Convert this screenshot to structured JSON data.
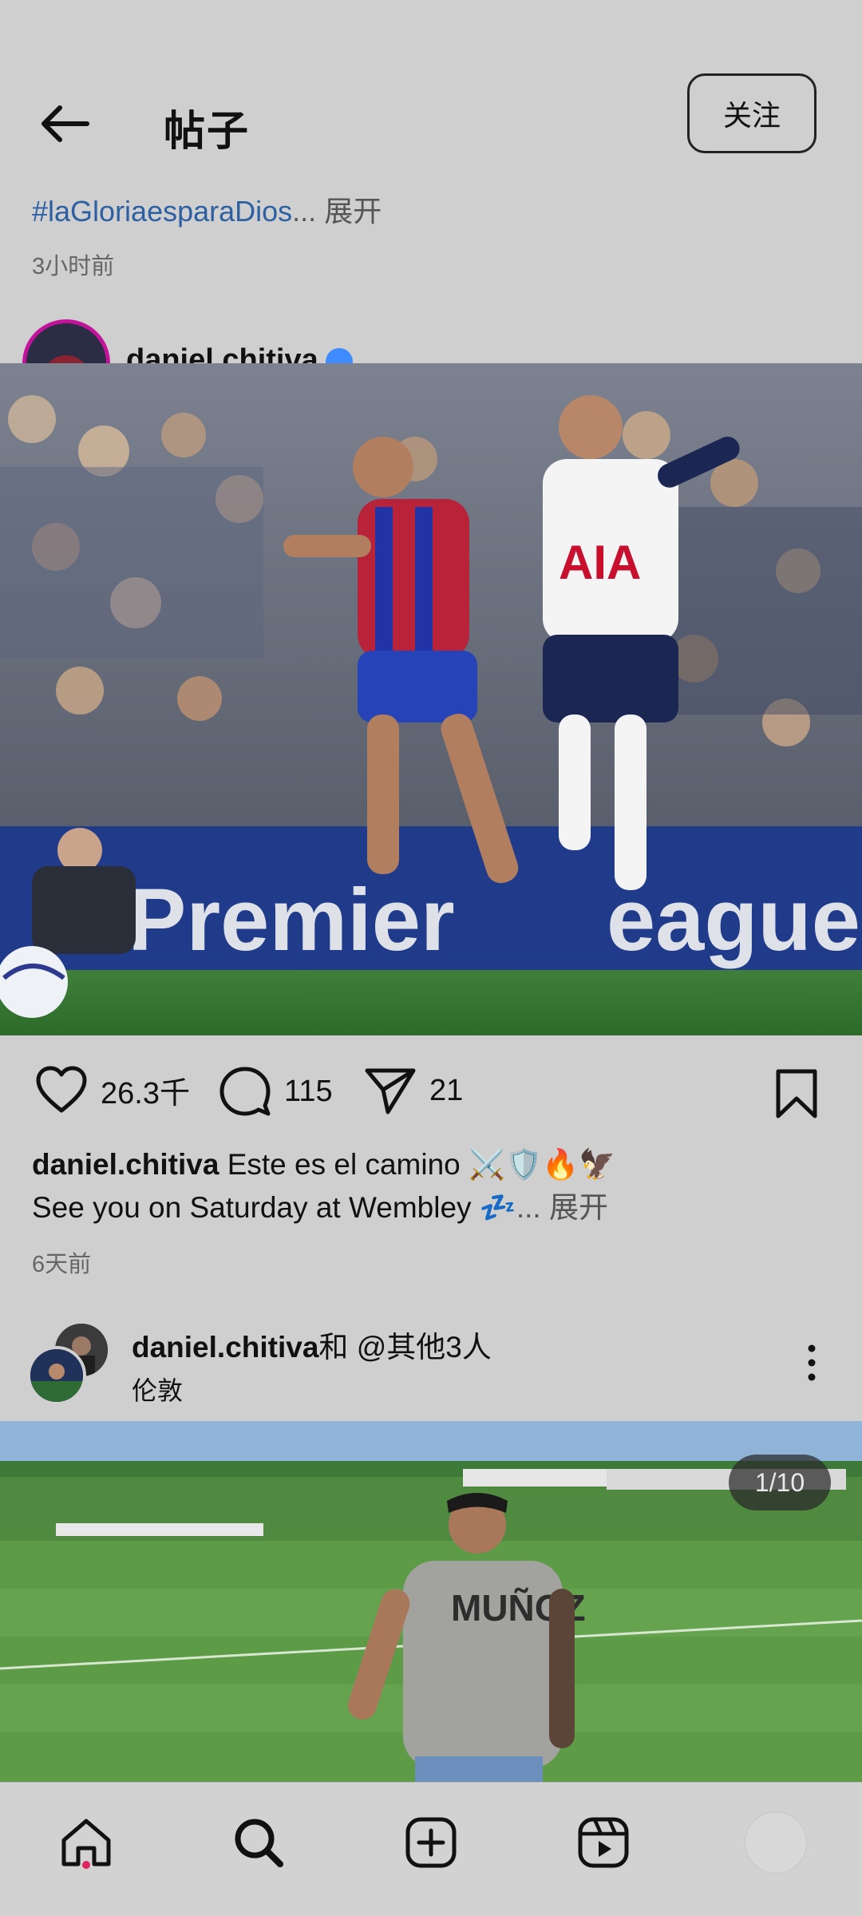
{
  "header": {
    "title": "帖子",
    "follow_label": "关注"
  },
  "prev_post": {
    "caption_hashtag": "#laGloriaesparaDios",
    "caption_ellipsis": "...",
    "expand_label": "展开",
    "time": "3小时前"
  },
  "post": {
    "username": "daniel.chitiva",
    "likes": "26.3千",
    "comments": "115",
    "shares": "21",
    "caption_line1": "Este es el camino ⚔️🛡️🔥🦅",
    "caption_line2": "See you on Saturday at Wembley 💤",
    "caption_ellipsis": "...",
    "expand_label": "展开",
    "time": "6天前"
  },
  "next_post": {
    "username": "daniel.chitiva",
    "and_others": "和 @其他3人",
    "location": "伦敦",
    "page_indicator": "1/10"
  },
  "nav": {
    "items": [
      "home-icon",
      "search-icon",
      "create-icon",
      "reels-icon",
      "profile-avatar"
    ]
  },
  "colors": {
    "background": "#cfcfcf",
    "link": "#2d5fa3",
    "story_ring": "#c3139b",
    "verified": "#3d8bff",
    "notification_dot": "#e0245e"
  }
}
